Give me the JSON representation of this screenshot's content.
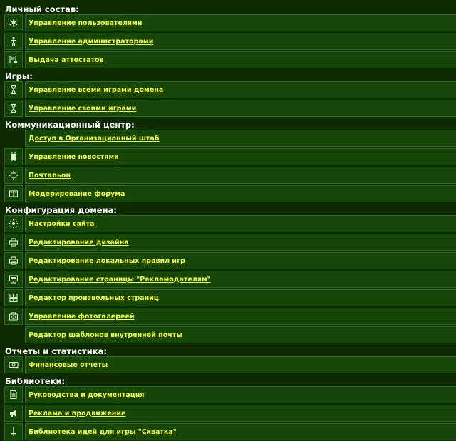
{
  "sections": [
    {
      "title": "Личный состав:",
      "items": [
        {
          "label": "Управление пользователями",
          "icon": "snowflake-icon"
        },
        {
          "label": "Управление администраторами",
          "icon": "person-icon"
        },
        {
          "label": "Выдача аттестатов",
          "icon": "certificate-icon"
        }
      ]
    },
    {
      "title": "Игры:",
      "items": [
        {
          "label": "Управление всеми играми домена",
          "icon": "hourglass-icon"
        },
        {
          "label": "Управление своими играми",
          "icon": "hourglass-icon"
        }
      ]
    },
    {
      "title": "Коммуникационный центр:",
      "items": [
        {
          "label": "Доступ в Организационный штаб",
          "icon": ""
        },
        {
          "label": "Управление новостями",
          "icon": "chip-icon"
        },
        {
          "label": "Почтальон",
          "icon": "mail-arrows-icon"
        },
        {
          "label": "Модерирование форума",
          "icon": "book-icon"
        }
      ]
    },
    {
      "title": "Конфигурация домена:",
      "items": [
        {
          "label": "Настройки сайта",
          "icon": "settings-icon"
        },
        {
          "label": "Редактирование дизайна",
          "icon": "printer-icon"
        },
        {
          "label": "Редактирование локальных правил игр",
          "icon": "printer-icon"
        },
        {
          "label": "Редактирование страницы \"Рекламодателям\"",
          "icon": "monitor-icon"
        },
        {
          "label": "Редактор произвольных страниц",
          "icon": "pages-icon"
        },
        {
          "label": "Управление фотогалереей",
          "icon": "camera-icon"
        },
        {
          "label": "Редактор шаблонов внутренней почты",
          "icon": ""
        }
      ]
    },
    {
      "title": "Отчеты и статистика:",
      "items": [
        {
          "label": "Финансовые отчеты",
          "icon": "money-icon"
        }
      ]
    },
    {
      "title": "Библиотеки:",
      "items": [
        {
          "label": "Руководства и документация",
          "icon": "document-icon"
        },
        {
          "label": "Реклама и продвижение",
          "icon": "megaphone-icon"
        },
        {
          "label": "Библиотека идей для игры \"Схватка\"",
          "icon": "sword-icon"
        }
      ]
    }
  ],
  "colors": {
    "background": "#0d2a00",
    "link": "#f4ff3a",
    "heading": "#ffffff",
    "row": "#164608"
  }
}
